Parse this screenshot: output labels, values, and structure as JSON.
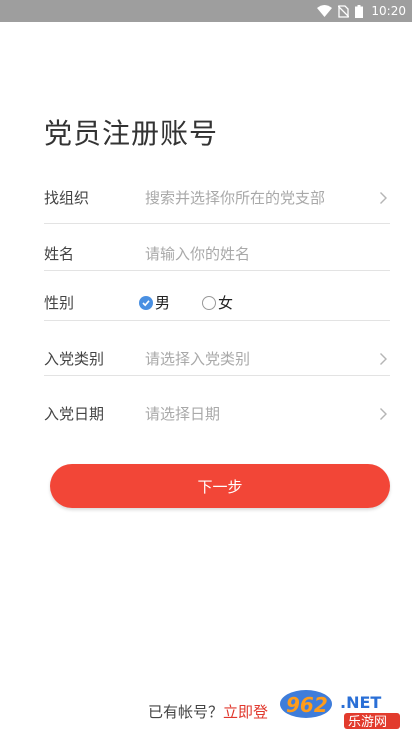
{
  "status_bar": {
    "time": "10:20",
    "icons": [
      "wifi-icon",
      "no-sim-icon",
      "battery-icon"
    ]
  },
  "page": {
    "title": "党员注册账号"
  },
  "form": {
    "organization": {
      "label": "找组织",
      "placeholder": "搜索并选择你所在的党支部"
    },
    "name": {
      "label": "姓名",
      "placeholder": "请输入你的姓名"
    },
    "gender": {
      "label": "性别",
      "options": [
        {
          "label": "男",
          "selected": true
        },
        {
          "label": "女",
          "selected": false
        }
      ]
    },
    "category": {
      "label": "入党类别",
      "placeholder": "请选择入党类别"
    },
    "date": {
      "label": "入党日期",
      "placeholder": "请选择日期"
    }
  },
  "next_button": {
    "label": "下一步"
  },
  "footer": {
    "prompt": "已有帐号？",
    "login_link": "立即登"
  },
  "watermark": {
    "text_top": "962",
    "text_net": ".NET",
    "text_bottom": "乐游网"
  },
  "colors": {
    "accent": "#f24637",
    "radio_checked": "#4a90e2",
    "status_bar": "#9e9e9e"
  }
}
